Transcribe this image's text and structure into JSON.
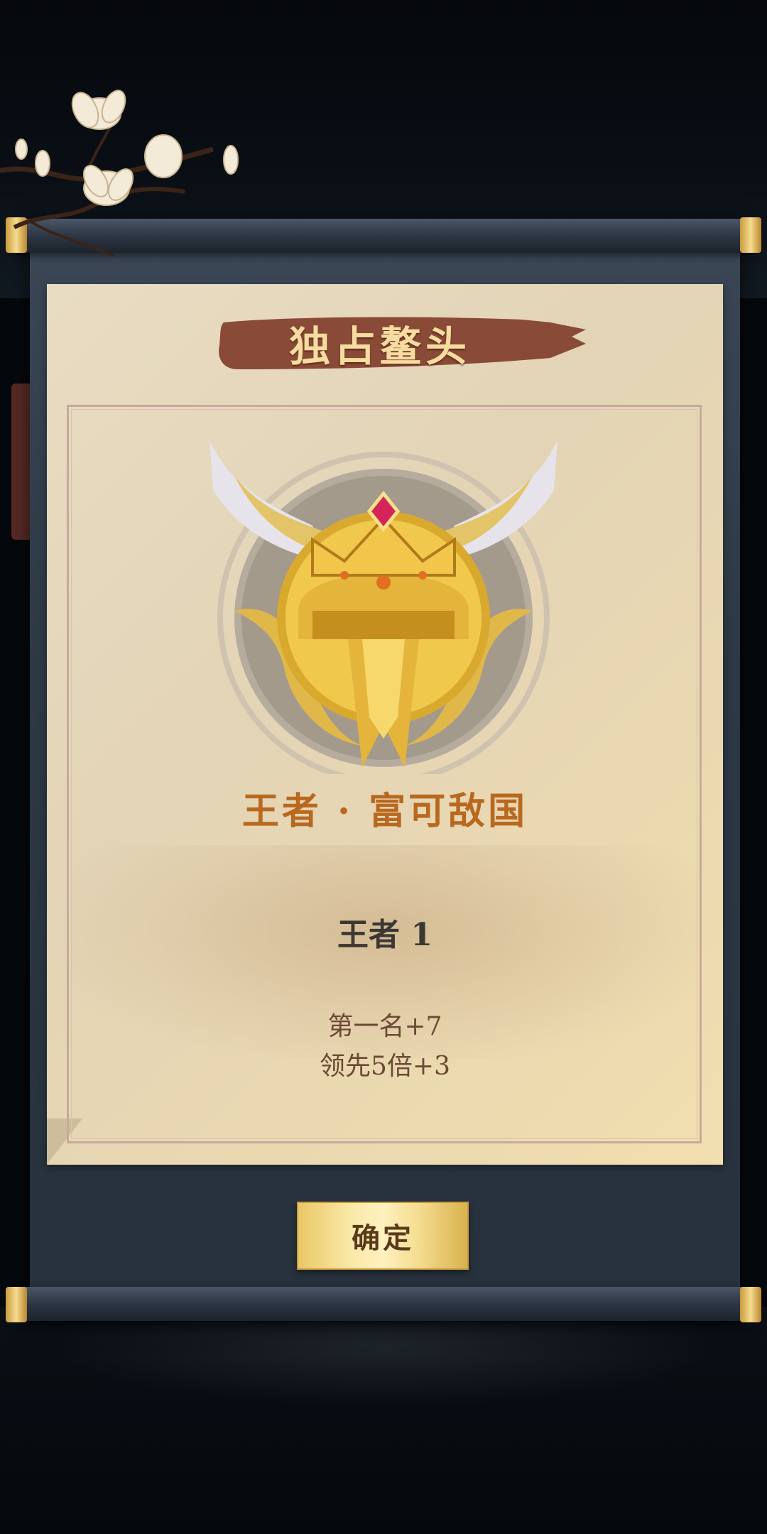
{
  "popup": {
    "banner_title": "独占鳌头",
    "rank_title": "王者 · 富可敌国",
    "rank_level": "王者 1",
    "bonuses": [
      "第一名+7",
      "领先5倍+3"
    ],
    "confirm_label": "确定"
  },
  "icons": {
    "emblem": "golden-winged-helmet-crown-emblem",
    "decoration": "magnolia-branch"
  },
  "colors": {
    "banner_bg": "#8a4a38",
    "banner_text": "#f7dca0",
    "rank_title": "#b8691f",
    "button_gold": "#f5de93"
  }
}
